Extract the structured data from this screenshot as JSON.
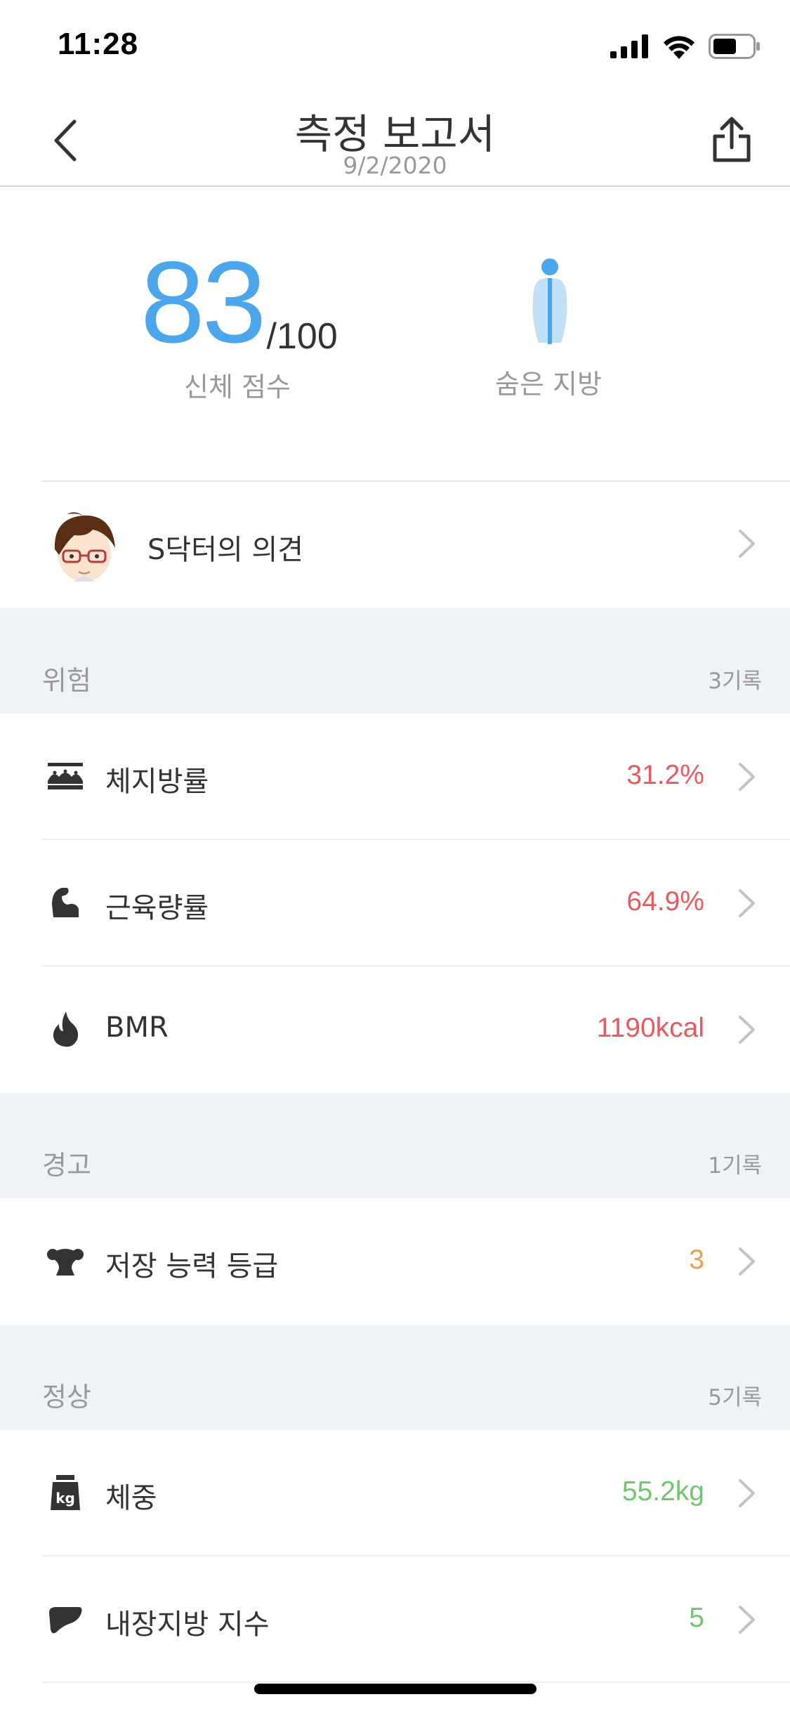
{
  "status_bar": {
    "time": "11:28"
  },
  "header": {
    "title": "측정 보고서",
    "date": "9/2/2020"
  },
  "score": {
    "value": "83",
    "total": "/100",
    "label": "신체 점수"
  },
  "body_type": {
    "label": "숨은 지방"
  },
  "doctor": {
    "label": "S닥터의 의견"
  },
  "sections": [
    {
      "title": "위험",
      "count": "3기록",
      "items": [
        {
          "icon": "body-fat-icon",
          "label": "체지방률",
          "value": "31.2%",
          "color": "#e85a5f"
        },
        {
          "icon": "muscle-icon",
          "label": "근육량률",
          "value": "64.9%",
          "color": "#e85a5f"
        },
        {
          "icon": "flame-icon",
          "label": "BMR",
          "value": "1190kcal",
          "color": "#e85a5f"
        }
      ]
    },
    {
      "title": "경고",
      "count": "1기록",
      "items": [
        {
          "icon": "strength-icon",
          "label": "저장 능력 등급",
          "value": "3",
          "color": "#eaa04a"
        }
      ]
    },
    {
      "title": "정상",
      "count": "5기록",
      "items": [
        {
          "icon": "weight-icon",
          "label": "체중",
          "value": "55.2kg",
          "color": "#6dc76b"
        },
        {
          "icon": "liver-icon",
          "label": "내장지방 지수",
          "value": "5",
          "color": "#6dc76b"
        }
      ]
    }
  ],
  "colors": {
    "accent": "#4ba6ec",
    "danger": "#e85a5f",
    "warning": "#eaa04a",
    "normal": "#6dc76b",
    "section_bg": "#eff2f6"
  }
}
